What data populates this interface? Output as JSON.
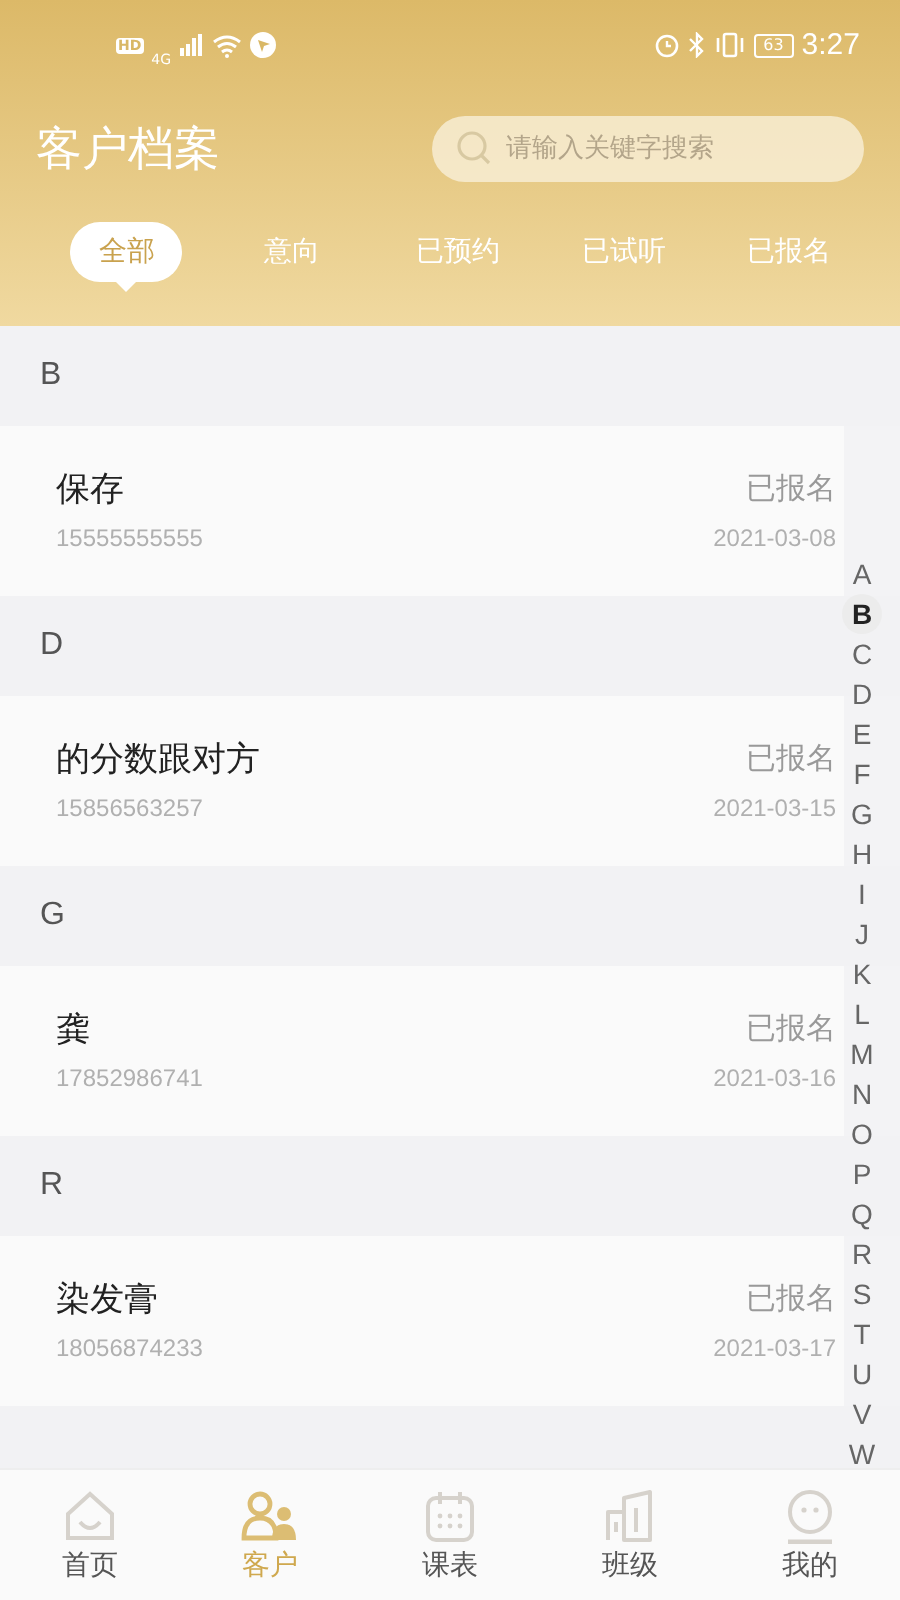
{
  "status_bar": {
    "hd": "HD",
    "network": "4G",
    "battery": "63",
    "time": "3:27"
  },
  "header": {
    "title": "客户档案",
    "search": {
      "placeholder": "请输入关键字搜索"
    }
  },
  "tabs": [
    {
      "label": "全部",
      "selected": true
    },
    {
      "label": "意向",
      "selected": false
    },
    {
      "label": "已预约",
      "selected": false
    },
    {
      "label": "已试听",
      "selected": false
    },
    {
      "label": "已报名",
      "selected": false
    }
  ],
  "groups": [
    {
      "letter": "B",
      "customers": [
        {
          "name": "保存",
          "phone": "15555555555",
          "status": "已报名",
          "date": "2021-03-08"
        }
      ]
    },
    {
      "letter": "D",
      "customers": [
        {
          "name": "的分数跟对方",
          "phone": "15856563257",
          "status": "已报名",
          "date": "2021-03-15"
        }
      ]
    },
    {
      "letter": "G",
      "customers": [
        {
          "name": "龚",
          "phone": "17852986741",
          "status": "已报名",
          "date": "2021-03-16"
        }
      ]
    },
    {
      "letter": "R",
      "customers": [
        {
          "name": "染发膏",
          "phone": "18056874233",
          "status": "已报名",
          "date": "2021-03-17"
        }
      ]
    }
  ],
  "index": [
    {
      "letter": "A",
      "selected": false
    },
    {
      "letter": "B",
      "selected": true
    },
    {
      "letter": "C",
      "selected": false
    },
    {
      "letter": "D",
      "selected": false
    },
    {
      "letter": "E",
      "selected": false
    },
    {
      "letter": "F",
      "selected": false
    },
    {
      "letter": "G",
      "selected": false
    },
    {
      "letter": "H",
      "selected": false
    },
    {
      "letter": "I",
      "selected": false
    },
    {
      "letter": "J",
      "selected": false
    },
    {
      "letter": "K",
      "selected": false
    },
    {
      "letter": "L",
      "selected": false
    },
    {
      "letter": "M",
      "selected": false
    },
    {
      "letter": "N",
      "selected": false
    },
    {
      "letter": "O",
      "selected": false
    },
    {
      "letter": "P",
      "selected": false
    },
    {
      "letter": "Q",
      "selected": false
    },
    {
      "letter": "R",
      "selected": false
    },
    {
      "letter": "S",
      "selected": false
    },
    {
      "letter": "T",
      "selected": false
    },
    {
      "letter": "U",
      "selected": false
    },
    {
      "letter": "V",
      "selected": false
    },
    {
      "letter": "W",
      "selected": false
    }
  ],
  "bottom_nav": [
    {
      "kind": "home",
      "label": "首页",
      "selected": false
    },
    {
      "kind": "people",
      "label": "客户",
      "selected": true
    },
    {
      "kind": "calendar",
      "label": "课表",
      "selected": false
    },
    {
      "kind": "building",
      "label": "班级",
      "selected": false
    },
    {
      "kind": "face",
      "label": "我的",
      "selected": false
    }
  ]
}
